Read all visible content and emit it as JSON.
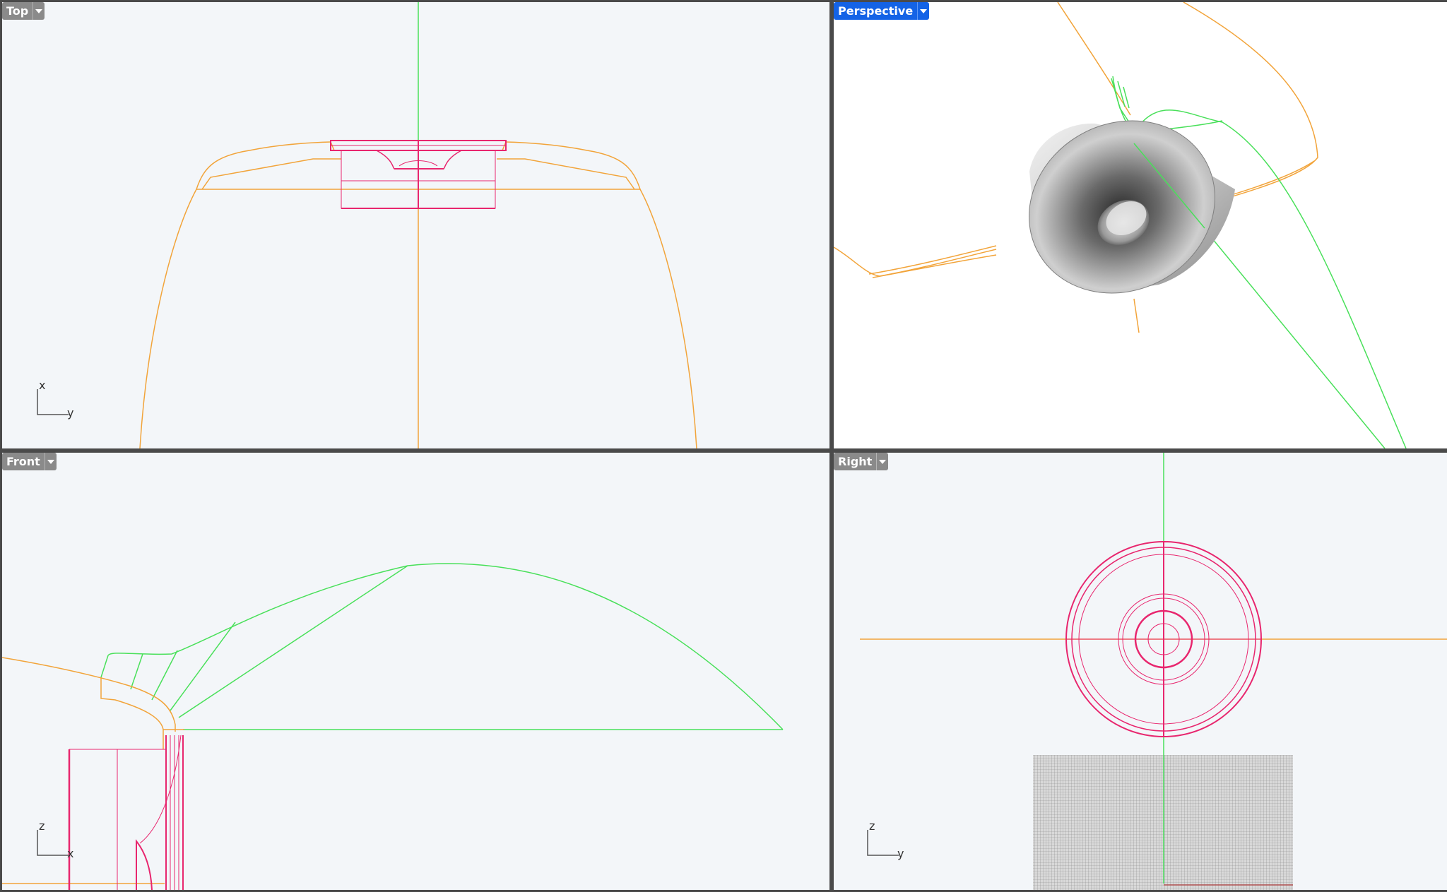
{
  "viewports": {
    "top": {
      "label": "Top",
      "axis_h": "y",
      "axis_v": "x"
    },
    "perspective": {
      "label": "Perspective"
    },
    "front": {
      "label": "Front",
      "axis_h": "x",
      "axis_v": "z"
    },
    "right": {
      "label": "Right",
      "axis_h": "y",
      "axis_v": "z"
    }
  },
  "colors": {
    "viewport_bg": "#f3f6f9",
    "perspective_bg": "#ffffff",
    "frame": "#4a4a4a",
    "curve_orange": "#f2a43a",
    "curve_green": "#49e05a",
    "curve_magenta": "#e8266e",
    "tab_inactive": "#8a8a8a",
    "tab_active": "#1463e6"
  }
}
